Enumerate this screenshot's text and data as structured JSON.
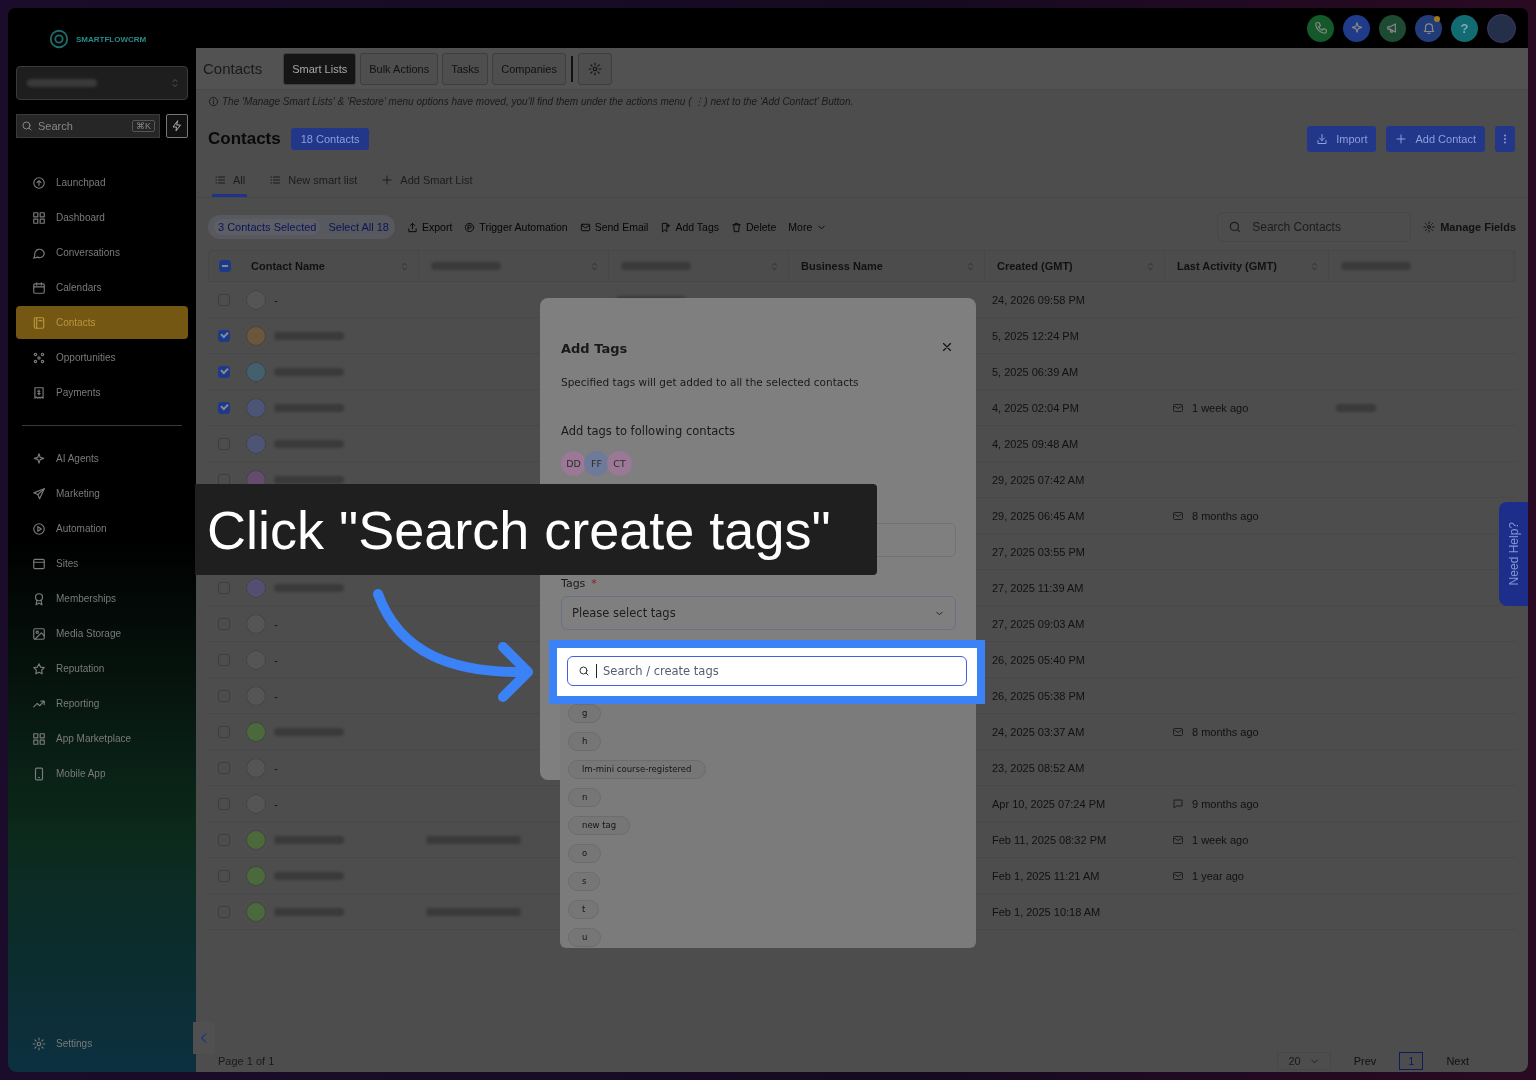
{
  "top_bar": {
    "logo_text": "SMARTFLOWCRM",
    "icons": [
      {
        "kind": "phone"
      },
      {
        "kind": "sparkle"
      },
      {
        "kind": "megaphone"
      },
      {
        "kind": "bell",
        "badge": true
      },
      {
        "kind": "help",
        "label": "?"
      },
      {
        "kind": "avatar"
      }
    ]
  },
  "sidebar": {
    "search": {
      "placeholder": "Search",
      "shortcut": "⌘K"
    },
    "sections": [
      {
        "items": [
          {
            "label": "Launchpad",
            "selected": false
          },
          {
            "label": "Dashboard",
            "selected": false
          },
          {
            "label": "Conversations",
            "selected": false
          },
          {
            "label": "Calendars",
            "selected": false
          },
          {
            "label": "Contacts",
            "selected": true
          },
          {
            "label": "Opportunities",
            "selected": false
          },
          {
            "label": "Payments",
            "selected": false
          }
        ]
      },
      {
        "items": [
          {
            "label": "AI Agents",
            "selected": false
          },
          {
            "label": "Marketing",
            "selected": false
          },
          {
            "label": "Automation",
            "selected": false
          },
          {
            "label": "Sites",
            "selected": false
          },
          {
            "label": "Memberships",
            "selected": false
          },
          {
            "label": "Media Storage",
            "selected": false
          },
          {
            "label": "Reputation",
            "selected": false
          },
          {
            "label": "Reporting",
            "selected": false
          },
          {
            "label": "App Marketplace",
            "selected": false
          },
          {
            "label": "Mobile App",
            "selected": false
          }
        ]
      }
    ],
    "footer_item": {
      "label": "Settings"
    }
  },
  "header": {
    "title": "Contacts",
    "tabs": [
      {
        "label": "Smart Lists",
        "selected": true
      },
      {
        "label": "Bulk Actions",
        "selected": false
      },
      {
        "label": "Tasks",
        "selected": false
      },
      {
        "label": "Companies",
        "selected": false
      }
    ]
  },
  "notice": "The 'Manage Smart Lists' & 'Restore' menu options have moved, you’ll find them under the actions menu ( ⋮) next to the 'Add Contact' Button.",
  "page": {
    "title": "Contacts",
    "count": "18 Contacts",
    "buttons": [
      {
        "label": "Import",
        "kind": "import"
      },
      {
        "label": "Add Contact",
        "kind": "add"
      }
    ]
  },
  "list_tabs": [
    {
      "label": "All",
      "kind": "list",
      "selected": true
    },
    {
      "label": "New smart list",
      "kind": "list",
      "selected": false
    },
    {
      "label": "Add Smart List",
      "kind": "add",
      "selected": false
    }
  ],
  "bulk_bar": {
    "selected_count": "3 Contacts Selected",
    "select_all": "Select All 18",
    "actions": [
      "Export",
      "Trigger Automation",
      "Send Email",
      "Add Tags",
      "Delete",
      "More"
    ],
    "search_placeholder": "Search Contacts",
    "manage_fields": "Manage Fields"
  },
  "table": {
    "indeterminate": true,
    "columns": [
      {
        "label": "Contact Name",
        "sortable": true
      },
      {
        "blurred": true,
        "sortable": true
      },
      {
        "blurred": true,
        "sortable": true
      },
      {
        "label": "Business Name",
        "sortable": true
      },
      {
        "label": "Created (GMT)",
        "sortable": true
      },
      {
        "label": "Last Activity (GMT)",
        "sortable": true
      },
      {
        "blurred": true,
        "sortable": false
      }
    ],
    "rows": [
      {
        "checked": false,
        "color": "#555555",
        "name": "-",
        "email_blurred": true,
        "created": "24, 2026 09:58 PM"
      },
      {
        "checked": true,
        "color": "#6e5638",
        "name_blurred": true,
        "created": "5, 2025 12:24 PM"
      },
      {
        "checked": true,
        "color": "#44606e",
        "name_blurred": true,
        "created": "5, 2025 06:39 AM"
      },
      {
        "checked": true,
        "color": "#4c5577",
        "name_blurred": true,
        "created": "4, 2025 02:04 PM",
        "activity": {
          "kind": "email",
          "text": "1 week ago"
        },
        "tags_blurred": true
      },
      {
        "checked": false,
        "color": "#4c5577",
        "name_blurred": true,
        "created": "4, 2025 09:48 AM"
      },
      {
        "checked": false,
        "color": "#634c6e",
        "name_blurred": true,
        "created": "29, 2025 07:42 AM"
      },
      {
        "created": "29, 2025 06:45 AM",
        "activity": {
          "kind": "email",
          "text": "8 months ago"
        }
      },
      {
        "created": "27, 2025 03:55 PM"
      },
      {
        "checked": false,
        "color": "#564e72",
        "name_blurred": true,
        "created": "27, 2025 11:39 AM"
      },
      {
        "checked": false,
        "color": "#555555",
        "name": "-",
        "created": "27, 2025 09:03 AM"
      },
      {
        "checked": false,
        "color": "#555555",
        "name": "-",
        "created": "26, 2025 05:40 PM"
      },
      {
        "checked": false,
        "color": "#555555",
        "name": "-",
        "created": "26, 2025 05:38 PM"
      },
      {
        "checked": false,
        "color": "#4b6a3c",
        "name_blurred": true,
        "created": "24, 2025 03:37 AM",
        "activity": {
          "kind": "email",
          "text": "8 months ago"
        }
      },
      {
        "checked": false,
        "color": "#555555",
        "name": "-",
        "created": "23, 2025 08:52 AM"
      },
      {
        "checked": false,
        "color": "#555555",
        "name": "-",
        "created": "Apr 10, 2025 07:24 PM",
        "activity": {
          "kind": "chat",
          "text": "9 months ago"
        }
      },
      {
        "checked": false,
        "color": "#4b6a3c",
        "name_blurred": true,
        "phone_blurred": true,
        "created": "Feb 11, 2025 08:32 PM",
        "activity": {
          "kind": "email",
          "text": "1 week ago"
        }
      },
      {
        "checked": false,
        "color": "#4b6a3c",
        "name_blurred": true,
        "created": "Feb 1, 2025 11:21 AM",
        "activity": {
          "kind": "email",
          "text": "1 year ago"
        }
      },
      {
        "checked": false,
        "color": "#4b6a3c",
        "name_blurred": true,
        "phone_blurred": true,
        "created": "Feb 1, 2025 10:18 AM"
      }
    ]
  },
  "pagination": {
    "page_label": "Page 1 of 1",
    "page_size": "20",
    "prev": "Prev",
    "current": "1",
    "next": "Next"
  },
  "help_tab": "Need Help?",
  "modal": {
    "title": "Add Tags",
    "description": "Specified tags will get added to all the selected contacts",
    "contacts_label": "Add tags to following contacts",
    "contact_avatars": [
      {
        "initials": "DD",
        "color": "#9a7896"
      },
      {
        "initials": "FF",
        "color": "#6d7a99"
      },
      {
        "initials": "CT",
        "color": "#9a7896"
      }
    ],
    "tags_label": "Tags",
    "required_mark": "*",
    "tags_placeholder": "Please select tags",
    "dropdown": {
      "search_placeholder": "Search / create tags",
      "options": [
        "g",
        "h",
        "lm-mini course-registered",
        "n",
        "new tag",
        "o",
        "s",
        "t",
        "u"
      ]
    }
  },
  "tutorial": {
    "caption": "Click \"Search create tags\""
  }
}
